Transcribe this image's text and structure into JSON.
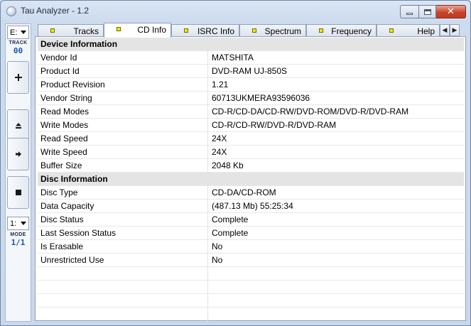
{
  "window": {
    "title": "Tau Analyzer - 1.2"
  },
  "leftbar": {
    "drive": "E:",
    "track_label": "TRACK",
    "track_value": "00",
    "buttons": [
      {
        "icon": "plus-icon",
        "glyph": "+"
      },
      {
        "icon": "eject-icon",
        "glyph": "⏏"
      },
      {
        "icon": "play-icon",
        "glyph": "➡"
      },
      {
        "icon": "stop-icon",
        "glyph": "■"
      }
    ],
    "mode_select": "1:",
    "mode_label": "MODE",
    "mode_value": "1/1"
  },
  "tabs": [
    {
      "label": "Tracks",
      "active": false
    },
    {
      "label": "CD Info",
      "active": true
    },
    {
      "label": "ISRC Info",
      "active": false
    },
    {
      "label": "Spectrum",
      "active": false
    },
    {
      "label": "Frequency",
      "active": false
    },
    {
      "label": "Help",
      "active": false
    }
  ],
  "tab_scroll": {
    "left": "◀",
    "right": "▶"
  },
  "info": {
    "device_header": "Device Information",
    "device_rows": [
      {
        "name": "Vendor Id",
        "value": "MATSHITA"
      },
      {
        "name": "Product Id",
        "value": "DVD-RAM UJ-850S"
      },
      {
        "name": "Product Revision",
        "value": "1.21"
      },
      {
        "name": "Vendor String",
        "value": "60713UKMERA93596036"
      },
      {
        "name": "Read Modes",
        "value": "CD-R/CD-DA/CD-RW/DVD-ROM/DVD-R/DVD-RAM"
      },
      {
        "name": "Write Modes",
        "value": "CD-R/CD-RW/DVD-R/DVD-RAM"
      },
      {
        "name": "Read Speed",
        "value": "24X"
      },
      {
        "name": "Write Speed",
        "value": "24X"
      },
      {
        "name": "Buffer Size",
        "value": "2048 Kb"
      }
    ],
    "disc_header": "Disc Information",
    "disc_rows": [
      {
        "name": "Disc Type",
        "value": "CD-DA/CD-ROM"
      },
      {
        "name": "Data Capacity",
        "value": "(487.13 Mb) 55:25:34"
      },
      {
        "name": "Disc Status",
        "value": "Complete"
      },
      {
        "name": "Last Session Status",
        "value": "Complete"
      },
      {
        "name": "Is Erasable",
        "value": "No"
      },
      {
        "name": "Unrestricted Use",
        "value": "No"
      }
    ]
  },
  "colors": {
    "tab_marker": "#f3ec00",
    "track_value": "#1d55b3",
    "close_button": "#c7452a"
  }
}
